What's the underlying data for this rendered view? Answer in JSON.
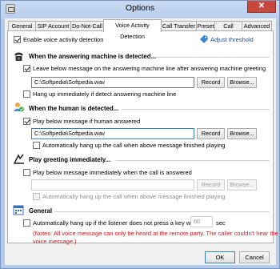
{
  "window": {
    "title": "Options",
    "close_glyph": "✕"
  },
  "tabs": [
    {
      "label": "General"
    },
    {
      "label": "SIP Account"
    },
    {
      "label": "Do-Not-Call"
    },
    {
      "label": "Voice Activity Detection"
    },
    {
      "label": "Call Transfer"
    },
    {
      "label": "Preset"
    },
    {
      "label": "Call Script"
    },
    {
      "label": "Advanced"
    }
  ],
  "active_tab": "Voice Activity Detection",
  "vad": {
    "enable_label": "Enable voice activity detection",
    "enable_checked": true,
    "adjust_label": "Adjust threshold"
  },
  "machine": {
    "title": "When the answering machine is detected...",
    "leave_label": "Leave below message on the answering machine line after answering machine greeting",
    "leave_checked": true,
    "file": "C:\\Softpedia\\Softpedia.wav",
    "record_label": "Record",
    "browse_label": "Browse...",
    "hangup_label": "Hang up immediately if detect answering machine line",
    "hangup_checked": false
  },
  "human": {
    "title": "When the human is detected...",
    "play_label": "Play below message if human answered",
    "play_checked": true,
    "file": "C:\\Softpedia\\Softpedia.wav",
    "record_label": "Record",
    "browse_label": "Browse...",
    "auto_hangup_label": "Automatically hang up the call when above message finished playing",
    "auto_hangup_checked": false
  },
  "greeting": {
    "title": "Play greeting immediately...",
    "play_label": "Play below message immediately when the call is answered",
    "play_checked": false,
    "file": "",
    "record_label": "Record",
    "browse_label": "Browse...",
    "auto_hangup_label": "Automatically hang up the call when above message finished playing",
    "auto_hangup_checked": false
  },
  "general": {
    "title": "General",
    "auto_hangup_label": "Automatically hang up if the listener does not press a key within",
    "auto_hangup_checked": false,
    "seconds": "60",
    "seconds_unit": "sec",
    "note": "(Notes: All voice message can only be heard at the remote party. The caller couldn't hear the voice message.)"
  },
  "footer": {
    "ok_label": "OK",
    "cancel_label": "Cancel"
  },
  "colors": {
    "note": "#d4181a",
    "link": "#1b4ea0",
    "frame": "#b3cbec"
  }
}
